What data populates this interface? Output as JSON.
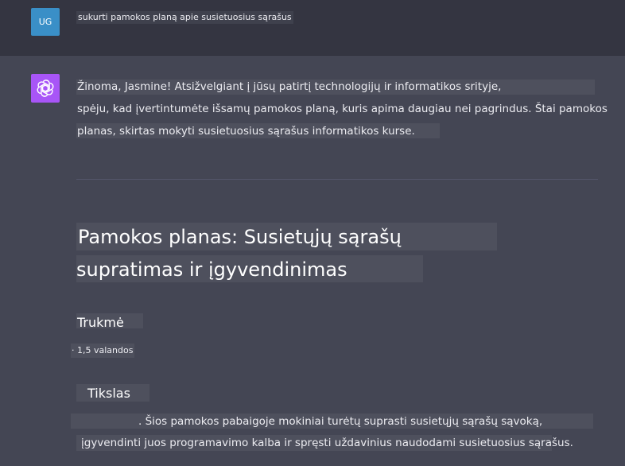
{
  "user": {
    "avatar_initials": "UG",
    "message": "sukurti pamokos planą apie susietuosius sąrašus"
  },
  "assistant": {
    "avatar_icon": "openai-logo-icon",
    "intro_lines": [
      "Žinoma, Jasmine! Atsižvelgiant į jūsų patirtį technologijų ir informatikos srityje,",
      "spėju, kad įvertintumėte išsamų pamokos planą, kuris apima daugiau nei pagrindus. Štai pamokos",
      "planas, skirtas mokyti susietuosius sąrašus informatikos kurse."
    ],
    "title_lines": [
      "Pamokos planas: Susietųjų sąrašų",
      "supratimas ir įgyvendinimas"
    ],
    "duration_heading": "Trukmė",
    "duration_bullet": "·",
    "duration_value": "1,5 valandos",
    "goal_heading": "Tikslas",
    "goal_lines": [
      ". Šios pamokos pabaigoje mokiniai turėtų suprasti susietųjų sąrašų sąvoką,",
      "įgyvendinti juos programavimo kalba ir spręsti uždavinius naudodami susietuosius sąrašus."
    ]
  },
  "colors": {
    "user_avatar": "#3a8fc7",
    "assistant_avatar": "#a855f7",
    "user_row_bg": "#343541",
    "assistant_row_bg": "#444654"
  }
}
